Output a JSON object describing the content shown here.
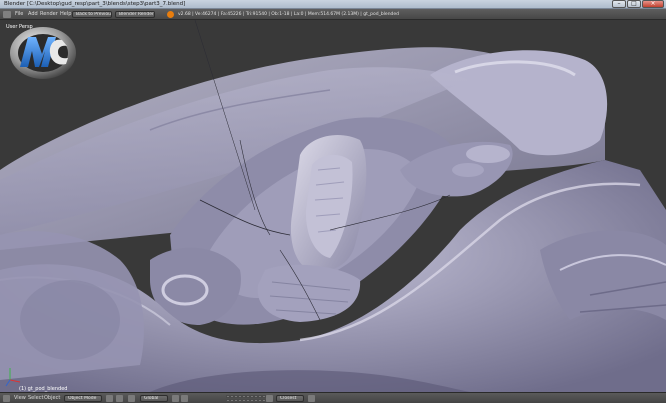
{
  "window": {
    "title": "Blender  [C:\\Desktop\\gud_resp\\part_3\\blends\\step3\\part3_7.blend]"
  },
  "header": {
    "menu": [
      "File",
      "Add",
      "Render",
      "Help"
    ],
    "screen_layout": "Back to Previous",
    "render_engine": "Blender Render",
    "stats": "v2.68 | Ve:46274 | Fa:45226 | Tri:91540 | Ob:1-18 | La:0 | Mem:514.67M (2.13M) | gt_pod_blended"
  },
  "viewport": {
    "view_label": "User Persp",
    "object_label": "(1) gt_pod_blended"
  },
  "footer": {
    "menu": [
      "View",
      "Select",
      "Object"
    ],
    "mode": "Object Mode",
    "pivot": "Global",
    "snap": "Closest"
  },
  "colors": {
    "background": "#3a3a3a",
    "model_light": "#cfcde0",
    "model_mid": "#a9a7c2",
    "model_dark": "#73718e",
    "header": "#4f4f4f",
    "watermark_blue": "#2f7fd6"
  },
  "icons": [
    "blender-logo-icon",
    "editor-type-icon",
    "minimize-icon",
    "maximize-icon",
    "close-icon",
    "axis-gizmo-icon"
  ]
}
